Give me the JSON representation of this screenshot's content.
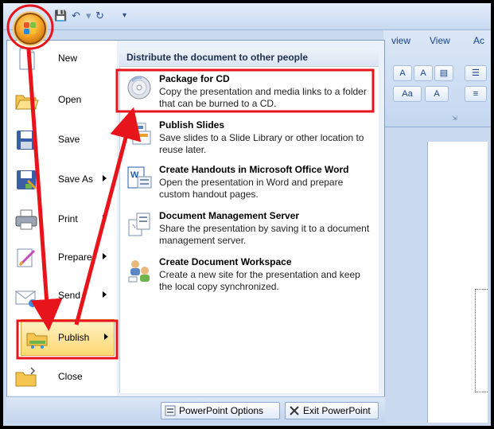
{
  "ribbon": {
    "tabs": [
      "view",
      "View",
      "Ac"
    ],
    "buttons": [
      "A",
      "A",
      "Aa",
      "A"
    ]
  },
  "menu": {
    "left_items": [
      {
        "label": "New",
        "key": "N",
        "rest": "ew",
        "icon": "new-document-icon",
        "has_arrow": false
      },
      {
        "label": "Open",
        "key": "O",
        "rest": "pen",
        "icon": "open-folder-icon",
        "has_arrow": false
      },
      {
        "label": "Save",
        "key": "S",
        "rest": "ave",
        "icon": "floppy-disk-icon",
        "has_arrow": false
      },
      {
        "label": "Save As",
        "key": "A",
        "rest": "Save ",
        "icon": "save-as-icon",
        "has_arrow": true
      },
      {
        "label": "Print",
        "key": "P",
        "rest": "rint",
        "icon": "printer-icon",
        "has_arrow": true
      },
      {
        "label": "Prepare",
        "key": "e",
        "rest": "Prepar",
        "icon": "prepare-icon",
        "has_arrow": true
      },
      {
        "label": "Send",
        "key": "d",
        "rest": "Sen",
        "icon": "send-icon",
        "has_arrow": true
      },
      {
        "label": "Publish",
        "key": "u",
        "rest": "P",
        "icon": "publish-icon",
        "has_arrow": true
      },
      {
        "label": "Close",
        "key": "C",
        "rest": "lose",
        "icon": "close-folder-icon",
        "has_arrow": false
      }
    ],
    "submenu_header": "Distribute the document to other people",
    "submenu_items": [
      {
        "title": "Package for CD",
        "desc": "Copy the presentation and media links to a folder that can be burned to a CD.",
        "icon": "cd-disc-icon"
      },
      {
        "title": "Publish Slides",
        "desc": "Save slides to a Slide Library or other location to reuse later.",
        "icon": "publish-slides-icon"
      },
      {
        "title": "Create Handouts in Microsoft Office Word",
        "desc": "Open the presentation in Word and prepare custom handout pages.",
        "icon": "word-handouts-icon"
      },
      {
        "title": "Document Management Server",
        "desc": "Share the presentation by saving it to a document management server.",
        "icon": "document-server-icon"
      },
      {
        "title": "Create Document Workspace",
        "desc": "Create a new site for the presentation and keep the local copy synchronized.",
        "icon": "workspace-people-icon"
      }
    ],
    "bottom_buttons": [
      {
        "label": "PowerPoint Options",
        "icon": "options-icon"
      },
      {
        "label": "Exit PowerPoint",
        "icon": "exit-x-icon"
      }
    ]
  },
  "colors": {
    "annotation_red": "#e8141b",
    "highlight_fill": "#ffd971"
  }
}
